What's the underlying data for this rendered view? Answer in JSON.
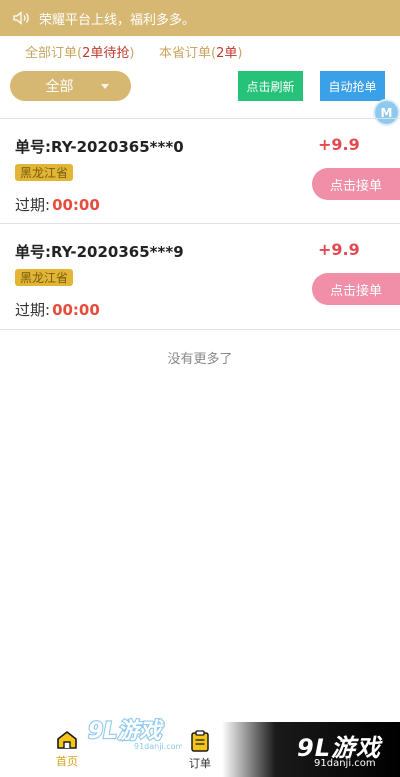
{
  "notice": {
    "icon": "speaker-icon",
    "text": "荣耀平台上线，福利多多。"
  },
  "tabs": {
    "all_prefix": "全部订单(",
    "all_count": "2单待抢",
    "all_suffix": ")",
    "province_prefix": "本省订单(",
    "province_count": "2单",
    "province_suffix": ")"
  },
  "filter": {
    "selected": "全部"
  },
  "toolbar": {
    "refresh_label": "点击刷新",
    "auto_label": "自动抢单"
  },
  "floating_badge": "M",
  "orders": [
    {
      "order_no": "单号:RY-2020365***0",
      "province": "黑龙江省",
      "expire_label": "过期:",
      "expire_time": "00:00",
      "amount": "+9.9",
      "accept_label": "点击接单"
    },
    {
      "order_no": "单号:RY-2020365***9",
      "province": "黑龙江省",
      "expire_label": "过期:",
      "expire_time": "00:00",
      "amount": "+9.9",
      "accept_label": "点击接单"
    }
  ],
  "list_end_text": "没有更多了",
  "tabbar": {
    "items": [
      {
        "label": "首页",
        "icon": "home-icon",
        "active": true
      },
      {
        "label": "订单",
        "icon": "clipboard-icon",
        "active": false
      }
    ]
  },
  "watermark": {
    "logo_left": "9L游戏",
    "site_left": "91danji.com",
    "logo_right": "9L游戏",
    "site_right": "91danji.com"
  },
  "colors": {
    "gold": "#d6b872",
    "green": "#27c27a",
    "blue": "#3aa0e8",
    "pink": "#f08fa7",
    "red": "#e34a50"
  }
}
